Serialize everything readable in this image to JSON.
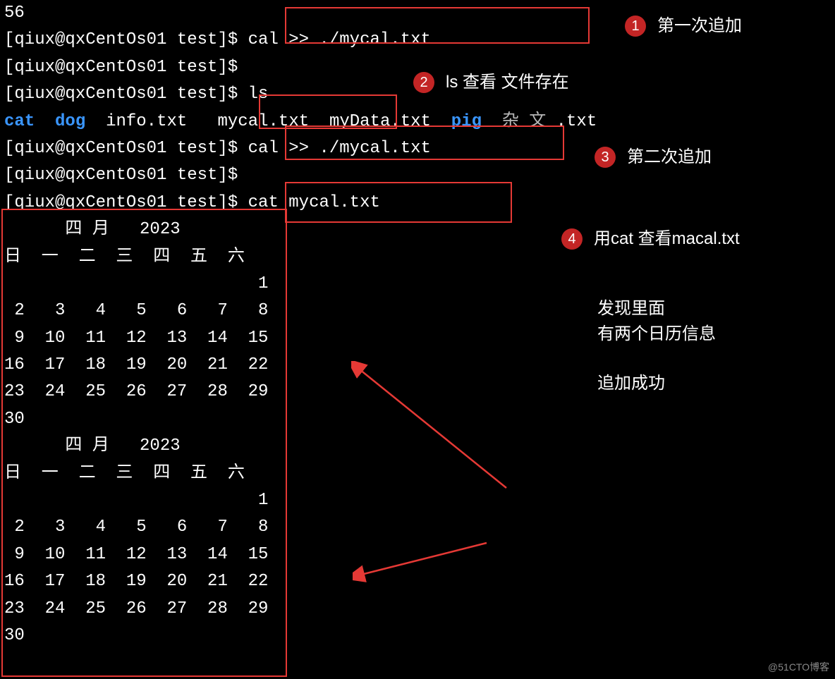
{
  "prompt": "[qiux@qxCentOs01 test]$ ",
  "lines": {
    "top_fragment": "56",
    "cmd_cal1": "cal >> ./mycal.txt",
    "cmd_ls": "ls",
    "cmd_cal2": "cal >> ./mycal.txt",
    "cmd_cat": "cat mycal.txt"
  },
  "ls_output": {
    "cat": "cat",
    "dog": "dog",
    "info": "info.txt",
    "mycal": "mycal.txt",
    "mydata": "myData.txt",
    "pig": "pig",
    "zawen_prefix": "杂 文 ",
    "zawen_ext": ".txt"
  },
  "calendar": {
    "title": "      四 月   2023",
    "header": "日  一  二  三  四  五  六",
    "rows": [
      "                         1",
      " 2   3   4   5   6   7   8",
      " 9  10  11  12  13  14  15",
      "16  17  18  19  20  21  22",
      "23  24  25  26  27  28  29",
      "30"
    ]
  },
  "annotations": {
    "a1": {
      "num": "1",
      "text": "第一次追加"
    },
    "a2": {
      "num": "2",
      "text": "ls 查看 文件存在"
    },
    "a3": {
      "num": "3",
      "text": "第二次追加"
    },
    "a4": {
      "num": "4",
      "text": "用cat 查看macal.txt"
    },
    "block1_l1": "发现里面",
    "block1_l2": "有两个日历信息",
    "block2": "追加成功"
  },
  "watermark": "@51CTO博客"
}
